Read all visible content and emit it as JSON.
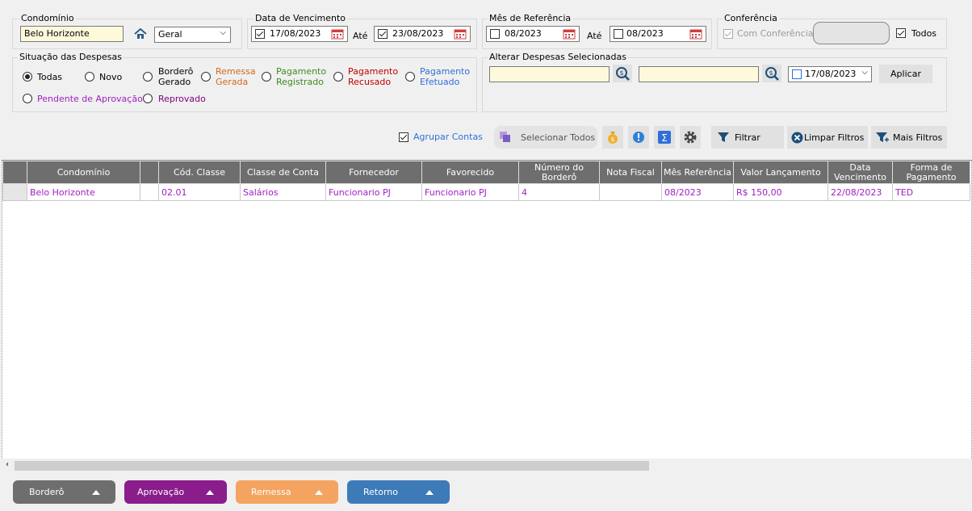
{
  "condominio": {
    "label": "Condomínio",
    "value": "Belo Horizonte",
    "select_value": "Geral"
  },
  "vencimento": {
    "label": "Data de Vencimento",
    "from": "17/08/2023",
    "to_label": "Até",
    "to": "23/08/2023"
  },
  "referencia": {
    "label": "Mês de Referência",
    "from": "08/2023",
    "to_label": "Até",
    "to": "08/2023"
  },
  "conferencia": {
    "label": "Conferência",
    "option": "Com Conferência",
    "todos": "Todos"
  },
  "situacao": {
    "label": "Situação das Despesas",
    "options": [
      {
        "label": "Todas",
        "color": "#000000"
      },
      {
        "label": "Novo",
        "color": "#000000"
      },
      {
        "label": "Borderô\nGerado",
        "color": "#000000"
      },
      {
        "label": "Remessa\nGerada",
        "color": "#d2691e"
      },
      {
        "label": "Pagamento\nRegistrado",
        "color": "#3c8c1e"
      },
      {
        "label": "Pagamento\nRecusado",
        "color": "#c00000"
      },
      {
        "label": "Pagamento\nEfetuado",
        "color": "#2f6fd8"
      },
      {
        "label": "Pendente de Aprovação",
        "color": "#a020c0"
      },
      {
        "label": "Reprovado",
        "color": "#800080"
      }
    ]
  },
  "alterar": {
    "label": "Alterar Despesas Selecionadas",
    "date": "17/08/2023",
    "apply": "Aplicar"
  },
  "toolbar": {
    "agrupar": "Agrupar Contas",
    "selecionar_todos": "Selecionar Todos",
    "filtrar": "Filtrar",
    "limpar": "Limpar Filtros",
    "mais": "Mais Filtros"
  },
  "table": {
    "columns": [
      "",
      "Condomínio",
      "",
      "Cód. Classe",
      "Classe de Conta",
      "Fornecedor",
      "Favorecido",
      "Número do\nBorderô",
      "Nota Fiscal",
      "Mês Referência",
      "Valor Lançamento",
      "Data\nVencimento",
      "Forma de\nPagamento"
    ],
    "rows": [
      [
        "",
        "Belo Horizonte",
        "",
        "02.01",
        "Salários",
        "Funcionario PJ",
        "Funcionario PJ",
        "4",
        "",
        "08/2023",
        "R$ 150,00",
        "22/08/2023",
        "TED"
      ]
    ]
  },
  "bottom": {
    "bordero": "Borderô",
    "aprovacao": "Aprovação",
    "remessa": "Remessa",
    "retorno": "Retorno"
  }
}
